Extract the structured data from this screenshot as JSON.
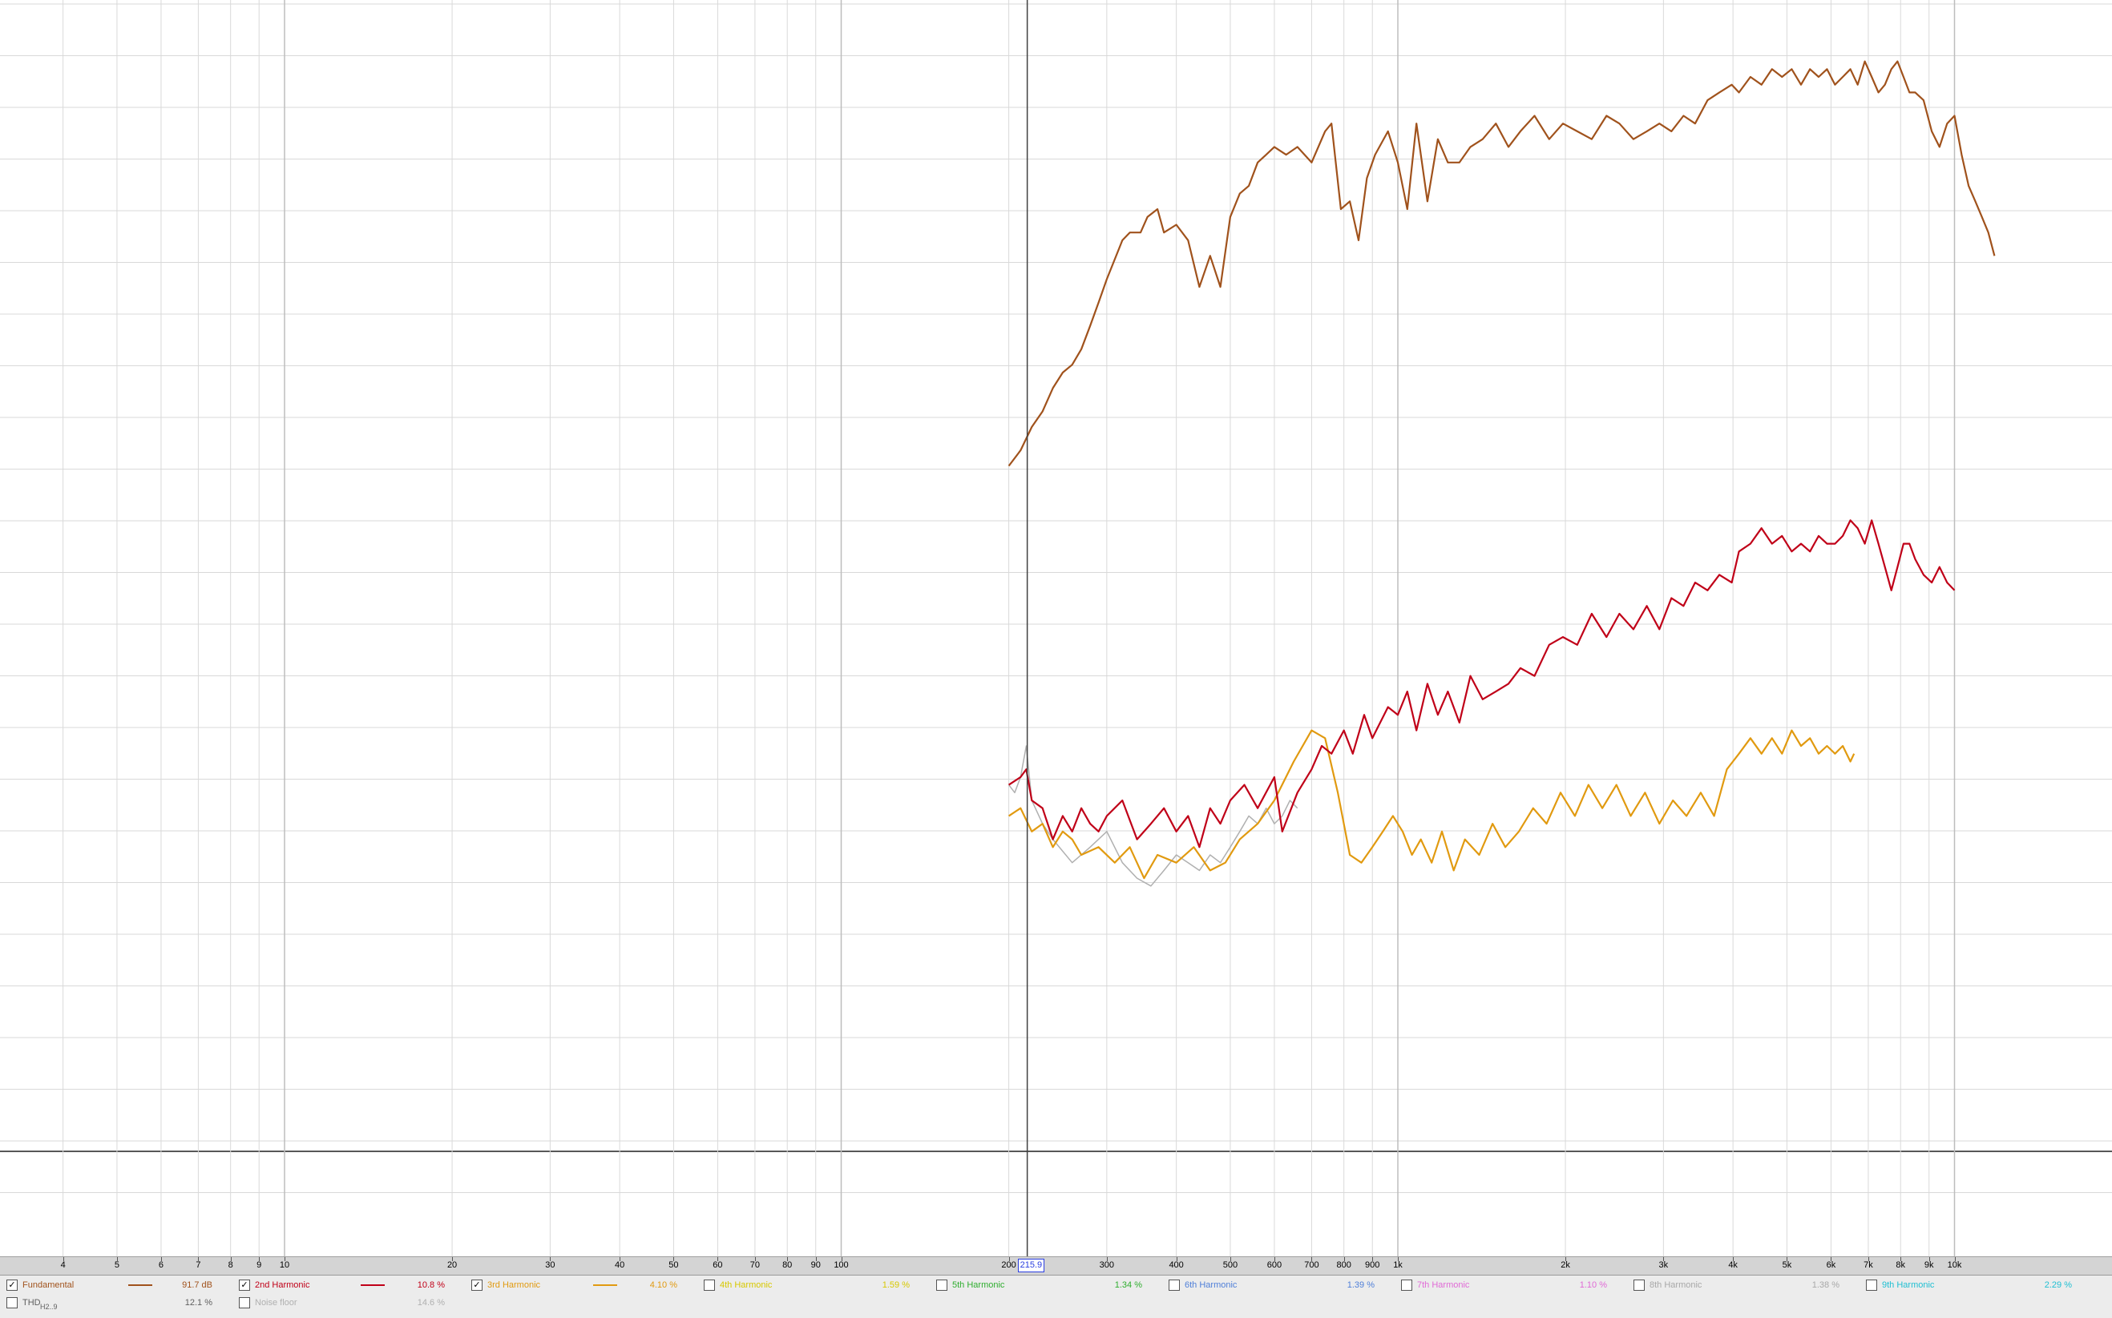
{
  "colors": {
    "background": "#ffffff",
    "grid_major": "#bdbdbd",
    "grid_minor": "#d9d9d9",
    "cursor": "#404040",
    "fundamental": "#a0521c",
    "h2": "#c00018",
    "h3": "#e19a10",
    "h4": "#d7c800",
    "h5": "#2fae2f",
    "h6": "#4f7fd8",
    "h7": "#e06ad6",
    "h8": "#a8a8a8",
    "h9": "#1fbfd2",
    "thd": "#606060",
    "noise": "#b0b0b0"
  },
  "axis": {
    "tick_labels": [
      "4",
      "5",
      "6",
      "7",
      "8",
      "9",
      "10",
      "20",
      "30",
      "40",
      "50",
      "60",
      "70",
      "80",
      "90",
      "100",
      "200",
      "300",
      "400",
      "500",
      "600",
      "700",
      "800",
      "900",
      "1k",
      "2k",
      "3k",
      "4k",
      "5k",
      "6k",
      "7k",
      "8k",
      "9k",
      "10k"
    ],
    "cursor_readout": "215.9"
  },
  "legend": {
    "row1": [
      {
        "label": "Fundamental",
        "checked": true,
        "value": "91.7 dB",
        "color_key": "fundamental",
        "swatch": true
      },
      {
        "label": "2nd Harmonic",
        "checked": true,
        "value": "10.8 %",
        "color_key": "h2",
        "swatch": true
      },
      {
        "label": "3rd Harmonic",
        "checked": true,
        "value": "4.10 %",
        "color_key": "h3",
        "swatch": true
      },
      {
        "label": "4th Harmonic",
        "checked": false,
        "value": "1.59 %",
        "color_key": "h4",
        "swatch": false
      },
      {
        "label": "5th Harmonic",
        "checked": false,
        "value": "1.34 %",
        "color_key": "h5",
        "swatch": false
      },
      {
        "label": "6th Harmonic",
        "checked": false,
        "value": "1.39 %",
        "color_key": "h6",
        "swatch": false
      },
      {
        "label": "7th Harmonic",
        "checked": false,
        "value": "1.10 %",
        "color_key": "h7",
        "swatch": false
      },
      {
        "label": "8th Harmonic",
        "checked": false,
        "value": "1.38 %",
        "color_key": "h8",
        "swatch": false
      },
      {
        "label": "9th Harmonic",
        "checked": false,
        "value": "2.29 %",
        "color_key": "h9",
        "swatch": false
      }
    ],
    "row2": [
      {
        "label": "THD",
        "label_sub": "H2..9",
        "checked": false,
        "value": "12.1 %",
        "color_key": "thd"
      },
      {
        "label": "Noise floor",
        "checked": false,
        "value": "14.6 %",
        "color_key": "noise"
      }
    ]
  },
  "chart_data": {
    "type": "line",
    "x_scale": "log",
    "xlim": [
      3.4,
      11800
    ],
    "xlabel": "",
    "ylabel": "",
    "title": "",
    "grid": true,
    "cursor_x": 215.9,
    "series": [
      {
        "name": "Fundamental",
        "color_key": "fundamental",
        "x": [
          200,
          210,
          220,
          230,
          240,
          250,
          260,
          270,
          280,
          290,
          300,
          320,
          330,
          345,
          355,
          370,
          380,
          400,
          420,
          440,
          460,
          480,
          500,
          520,
          540,
          560,
          580,
          600,
          630,
          660,
          700,
          740,
          760,
          790,
          820,
          850,
          880,
          910,
          960,
          1000,
          1040,
          1080,
          1130,
          1180,
          1230,
          1290,
          1350,
          1420,
          1500,
          1580,
          1660,
          1760,
          1870,
          1980,
          2100,
          2230,
          2370,
          2500,
          2650,
          2800,
          2950,
          3100,
          3260,
          3420,
          3600,
          3780,
          3980,
          4100,
          4300,
          4500,
          4700,
          4900,
          5100,
          5300,
          5500,
          5700,
          5900,
          6100,
          6300,
          6500,
          6700,
          6900,
          7100,
          7300,
          7500,
          7700,
          7900,
          8100,
          8300,
          8500,
          8800,
          9100,
          9400,
          9700,
          10000,
          10300,
          10600,
          10900,
          11200,
          11500,
          11800
        ],
        "y": [
          -57,
          -55,
          -52,
          -50,
          -47,
          -45,
          -44,
          -42,
          -39,
          -36,
          -33,
          -28,
          -27,
          -27,
          -25,
          -24,
          -27,
          -26,
          -28,
          -34,
          -30,
          -34,
          -25,
          -22,
          -21,
          -18,
          -17,
          -16,
          -17,
          -16,
          -18,
          -14,
          -13,
          -24,
          -23,
          -28,
          -20,
          -17,
          -14,
          -18,
          -24,
          -13,
          -23,
          -15,
          -18,
          -18,
          -16,
          -15,
          -13,
          -16,
          -14,
          -12,
          -15,
          -13,
          -14,
          -15,
          -12,
          -13,
          -15,
          -14,
          -13,
          -14,
          -12,
          -13,
          -10,
          -9,
          -8,
          -9,
          -7,
          -8,
          -6,
          -7,
          -6,
          -8,
          -6,
          -7,
          -6,
          -8,
          -7,
          -6,
          -8,
          -5,
          -7,
          -9,
          -8,
          -6,
          -5,
          -7,
          -9,
          -9,
          -10,
          -14,
          -16,
          -13,
          -12,
          -17,
          -21,
          -23,
          -25,
          -27,
          -30
        ]
      },
      {
        "name": "2nd Harmonic",
        "color_key": "h2",
        "x": [
          200,
          210,
          215,
          220,
          230,
          240,
          250,
          260,
          270,
          280,
          290,
          300,
          320,
          340,
          360,
          380,
          400,
          420,
          440,
          460,
          480,
          500,
          530,
          560,
          600,
          620,
          660,
          700,
          730,
          760,
          800,
          830,
          870,
          900,
          960,
          1000,
          1040,
          1080,
          1130,
          1180,
          1230,
          1290,
          1350,
          1420,
          1500,
          1580,
          1660,
          1760,
          1870,
          1980,
          2100,
          2230,
          2370,
          2500,
          2650,
          2800,
          2950,
          3100,
          3260,
          3420,
          3600,
          3780,
          3980,
          4100,
          4300,
          4500,
          4700,
          4900,
          5100,
          5300,
          5500,
          5700,
          5900,
          6100,
          6300,
          6500,
          6700,
          6900,
          7100,
          7300,
          7500,
          7700,
          7900,
          8100,
          8300,
          8500,
          8800,
          9100,
          9400,
          9700,
          10000
        ],
        "y": [
          -98,
          -97,
          -96,
          -100,
          -101,
          -105,
          -102,
          -104,
          -101,
          -103,
          -104,
          -102,
          -100,
          -105,
          -103,
          -101,
          -104,
          -102,
          -106,
          -101,
          -103,
          -100,
          -98,
          -101,
          -97,
          -104,
          -99,
          -96,
          -93,
          -94,
          -91,
          -94,
          -89,
          -92,
          -88,
          -89,
          -86,
          -91,
          -85,
          -89,
          -86,
          -90,
          -84,
          -87,
          -86,
          -85,
          -83,
          -84,
          -80,
          -79,
          -80,
          -76,
          -79,
          -76,
          -78,
          -75,
          -78,
          -74,
          -75,
          -72,
          -73,
          -71,
          -72,
          -68,
          -67,
          -65,
          -67,
          -66,
          -68,
          -67,
          -68,
          -66,
          -67,
          -67,
          -66,
          -64,
          -65,
          -67,
          -64,
          -67,
          -70,
          -73,
          -70,
          -67,
          -67,
          -69,
          -71,
          -72,
          -70,
          -72,
          -73
        ]
      },
      {
        "name": "3rd Harmonic",
        "color_key": "h3",
        "x": [
          200,
          210,
          220,
          230,
          240,
          250,
          260,
          270,
          290,
          310,
          330,
          350,
          370,
          400,
          430,
          460,
          490,
          520,
          560,
          600,
          650,
          700,
          740,
          780,
          820,
          860,
          900,
          940,
          980,
          1020,
          1060,
          1100,
          1150,
          1200,
          1260,
          1320,
          1400,
          1480,
          1560,
          1650,
          1750,
          1850,
          1960,
          2080,
          2200,
          2330,
          2470,
          2620,
          2780,
          2950,
          3120,
          3300,
          3500,
          3700,
          3900,
          4100,
          4300,
          4500,
          4700,
          4900,
          5100,
          5300,
          5500,
          5700,
          5900,
          6100,
          6300,
          6500,
          6600
        ],
        "y": [
          -102,
          -101,
          -104,
          -103,
          -106,
          -104,
          -105,
          -107,
          -106,
          -108,
          -106,
          -110,
          -107,
          -108,
          -106,
          -109,
          -108,
          -105,
          -103,
          -100,
          -95,
          -91,
          -92,
          -99,
          -107,
          -108,
          -106,
          -104,
          -102,
          -104,
          -107,
          -105,
          -108,
          -104,
          -109,
          -105,
          -107,
          -103,
          -106,
          -104,
          -101,
          -103,
          -99,
          -102,
          -98,
          -101,
          -98,
          -102,
          -99,
          -103,
          -100,
          -102,
          -99,
          -102,
          -96,
          -94,
          -92,
          -94,
          -92,
          -94,
          -91,
          -93,
          -92,
          -94,
          -93,
          -94,
          -93,
          -95,
          -94
        ]
      },
      {
        "name": "Noise floor",
        "color_key": "noise",
        "x": [
          200,
          205,
          210,
          215,
          220,
          230,
          240,
          260,
          280,
          300,
          320,
          340,
          360,
          380,
          400,
          420,
          440,
          460,
          480,
          500,
          520,
          540,
          560,
          580,
          600,
          620,
          640,
          660
        ],
        "y": [
          -98,
          -99,
          -97,
          -93,
          -100,
          -103,
          -105,
          -108,
          -106,
          -104,
          -108,
          -110,
          -111,
          -109,
          -107,
          -108,
          -109,
          -107,
          -108,
          -106,
          -104,
          -102,
          -103,
          -101,
          -103,
          -102,
          -100,
          -101
        ]
      }
    ]
  }
}
